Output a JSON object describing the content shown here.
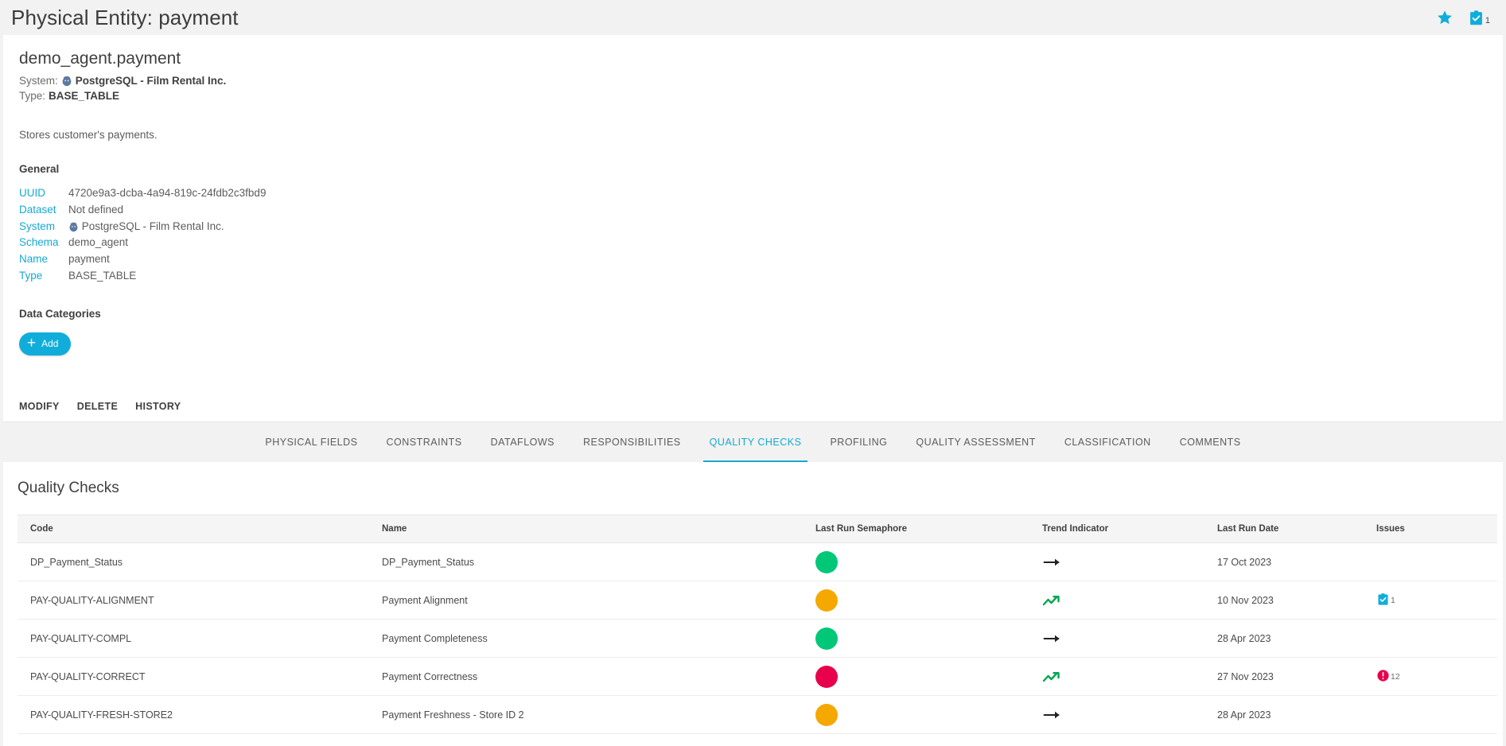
{
  "header": {
    "title": "Physical Entity: payment",
    "favorite_icon": "star-icon",
    "tasks_icon": "clipboard-check-icon",
    "tasks_count": "1"
  },
  "entity": {
    "name": "demo_agent.payment",
    "system_label": "System:",
    "system_value": "PostgreSQL - Film Rental Inc.",
    "type_label": "Type:",
    "type_value": "BASE_TABLE",
    "description": "Stores customer's payments."
  },
  "general": {
    "section_title": "General",
    "rows": [
      {
        "key": "UUID",
        "value": "4720e9a3-dcba-4a94-819c-24fdb2c3fbd9",
        "icon": ""
      },
      {
        "key": "Dataset",
        "value": "Not defined",
        "icon": ""
      },
      {
        "key": "System",
        "value": "PostgreSQL - Film Rental Inc.",
        "icon": "postgresql-icon"
      },
      {
        "key": "Schema",
        "value": "demo_agent",
        "icon": ""
      },
      {
        "key": "Name",
        "value": "payment",
        "icon": ""
      },
      {
        "key": "Type",
        "value": "BASE_TABLE",
        "icon": ""
      }
    ]
  },
  "data_categories": {
    "section_title": "Data Categories",
    "add_label": "Add"
  },
  "card_actions": [
    {
      "label": "MODIFY"
    },
    {
      "label": "DELETE"
    },
    {
      "label": "HISTORY"
    }
  ],
  "tabs": [
    {
      "label": "PHYSICAL FIELDS",
      "active": false
    },
    {
      "label": "CONSTRAINTS",
      "active": false
    },
    {
      "label": "DATAFLOWS",
      "active": false
    },
    {
      "label": "RESPONSIBILITIES",
      "active": false
    },
    {
      "label": "QUALITY CHECKS",
      "active": true
    },
    {
      "label": "PROFILING",
      "active": false
    },
    {
      "label": "QUALITY ASSESSMENT",
      "active": false
    },
    {
      "label": "CLASSIFICATION",
      "active": false
    },
    {
      "label": "COMMENTS",
      "active": false
    }
  ],
  "quality_checks": {
    "panel_title": "Quality Checks",
    "columns": [
      "Code",
      "Name",
      "Last Run Semaphore",
      "Trend Indicator",
      "Last Run Date",
      "Issues"
    ],
    "rows": [
      {
        "code": "DP_Payment_Status",
        "name": "DP_Payment_Status",
        "semaphore": "green",
        "trend": "flat",
        "last_run_date": "17 Oct 2023",
        "issue_type": "",
        "issue_count": ""
      },
      {
        "code": "PAY-QUALITY-ALIGNMENT",
        "name": "Payment Alignment",
        "semaphore": "orange",
        "trend": "up",
        "last_run_date": "10 Nov 2023",
        "issue_type": "task",
        "issue_count": "1"
      },
      {
        "code": "PAY-QUALITY-COMPL",
        "name": "Payment Completeness",
        "semaphore": "green",
        "trend": "flat",
        "last_run_date": "28 Apr 2023",
        "issue_type": "",
        "issue_count": ""
      },
      {
        "code": "PAY-QUALITY-CORRECT",
        "name": "Payment Correctness",
        "semaphore": "red",
        "trend": "up",
        "last_run_date": "27 Nov 2023",
        "issue_type": "alert",
        "issue_count": "12"
      },
      {
        "code": "PAY-QUALITY-FRESH-STORE2",
        "name": "Payment Freshness - Store ID 2",
        "semaphore": "orange",
        "trend": "flat",
        "last_run_date": "28 Apr 2023",
        "issue_type": "",
        "issue_count": ""
      }
    ]
  },
  "colors": {
    "accent": "#16a9d0",
    "add_button": "#11adda",
    "semaphore_green": "#00c878",
    "semaphore_orange": "#f5a800",
    "semaphore_red": "#e8004c",
    "trend_up": "#00a651",
    "trend_flat": "#222222",
    "issue_alert": "#e8004c",
    "issue_task": "#11adda"
  }
}
